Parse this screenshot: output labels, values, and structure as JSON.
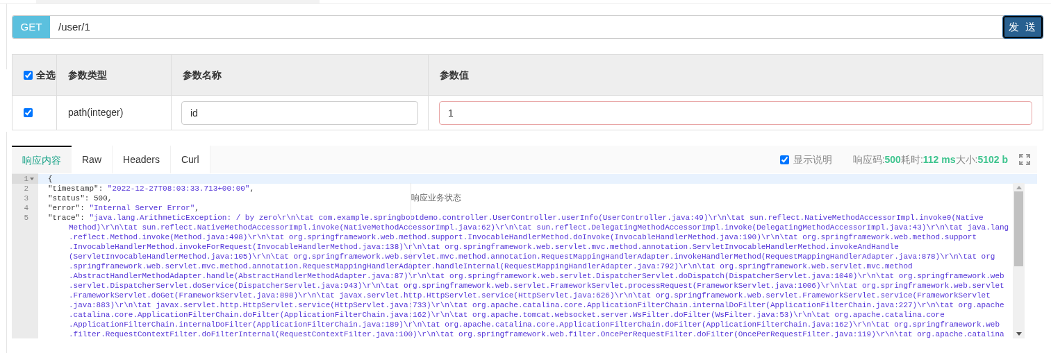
{
  "request": {
    "method": "GET",
    "url": "/user/1",
    "send_label": "发 送"
  },
  "params": {
    "select_all": {
      "label": "全选",
      "checked": true
    },
    "columns": [
      "参数类型",
      "参数名称",
      "参数值"
    ],
    "rows": [
      {
        "checked": true,
        "type": "path(integer)",
        "name": "id",
        "value": "1",
        "invalid": true
      }
    ]
  },
  "response_tabs": [
    {
      "label": "响应内容",
      "selected": true
    },
    {
      "label": "Raw",
      "selected": false
    },
    {
      "label": "Headers",
      "selected": false
    },
    {
      "label": "Curl",
      "selected": false
    }
  ],
  "show_description": {
    "label": "显示说明",
    "checked": true
  },
  "stats": [
    {
      "label": "响应码:",
      "value": "500"
    },
    {
      "label": "耗时:",
      "value": "112 ms"
    },
    {
      "label": "大小:",
      "value": "5102 b"
    }
  ],
  "editor": {
    "lines": [
      {
        "number": "1",
        "active": true,
        "foldable": true,
        "segments": [
          {
            "kind": "punct",
            "text": "{"
          }
        ]
      },
      {
        "number": "2",
        "active": false,
        "foldable": false,
        "segments": [
          {
            "kind": "key",
            "text": "\"timestamp\""
          },
          {
            "kind": "punct",
            "text": ": "
          },
          {
            "kind": "string",
            "text": "\"2022-12-27T08:03:33.713+00:00\""
          },
          {
            "kind": "punct",
            "text": ","
          }
        ]
      },
      {
        "number": "3",
        "active": false,
        "foldable": false,
        "note": "响应业务状态",
        "segments": [
          {
            "kind": "key",
            "text": "\"status\""
          },
          {
            "kind": "punct",
            "text": ": "
          },
          {
            "kind": "number",
            "text": "500"
          },
          {
            "kind": "punct",
            "text": ","
          }
        ]
      },
      {
        "number": "4",
        "active": false,
        "foldable": false,
        "segments": [
          {
            "kind": "key",
            "text": "\"error\""
          },
          {
            "kind": "punct",
            "text": ": "
          },
          {
            "kind": "string",
            "text": "\"Internal Server Error\""
          },
          {
            "kind": "punct",
            "text": ","
          }
        ]
      },
      {
        "number": "5",
        "active": false,
        "foldable": false,
        "segments": [
          {
            "kind": "key",
            "text": "\"trace\""
          },
          {
            "kind": "punct",
            "text": ": "
          },
          {
            "kind": "string",
            "text": "\"java.lang.ArithmeticException: / by zero\\r\\n\\tat com.example.springbootdemo.controller.UserController.userInfo(UserController.java:49)\\r\\n\\tat sun.reflect.NativeMethodAccessorImpl.invoke0(Native"
          }
        ],
        "continuation": [
          "Method)\\r\\n\\tat sun.reflect.NativeMethodAccessorImpl.invoke(NativeMethodAccessorImpl.java:62)\\r\\n\\tat sun.reflect.DelegatingMethodAccessorImpl.invoke(DelegatingMethodAccessorImpl.java:43)\\r\\n\\tat java.lang",
          ".reflect.Method.invoke(Method.java:498)\\r\\n\\tat org.springframework.web.method.support.InvocableHandlerMethod.doInvoke(InvocableHandlerMethod.java:190)\\r\\n\\tat org.springframework.web.method.support",
          ".InvocableHandlerMethod.invokeForRequest(InvocableHandlerMethod.java:138)\\r\\n\\tat org.springframework.web.servlet.mvc.method.annotation.ServletInvocableHandlerMethod.invokeAndHandle",
          "(ServletInvocableHandlerMethod.java:105)\\r\\n\\tat org.springframework.web.servlet.mvc.method.annotation.RequestMappingHandlerAdapter.invokeHandlerMethod(RequestMappingHandlerAdapter.java:878)\\r\\n\\tat org",
          ".springframework.web.servlet.mvc.method.annotation.RequestMappingHandlerAdapter.handleInternal(RequestMappingHandlerAdapter.java:792)\\r\\n\\tat org.springframework.web.servlet.mvc.method",
          ".AbstractHandlerMethodAdapter.handle(AbstractHandlerMethodAdapter.java:87)\\r\\n\\tat org.springframework.web.servlet.DispatcherServlet.doDispatch(DispatcherServlet.java:1040)\\r\\n\\tat org.springframework.web",
          ".servlet.DispatcherServlet.doService(DispatcherServlet.java:943)\\r\\n\\tat org.springframework.web.servlet.FrameworkServlet.processRequest(FrameworkServlet.java:1006)\\r\\n\\tat org.springframework.web.servlet",
          ".FrameworkServlet.doGet(FrameworkServlet.java:898)\\r\\n\\tat javax.servlet.http.HttpServlet.service(HttpServlet.java:626)\\r\\n\\tat org.springframework.web.servlet.FrameworkServlet.service(FrameworkServlet",
          ".java:883)\\r\\n\\tat javax.servlet.http.HttpServlet.service(HttpServlet.java:733)\\r\\n\\tat org.apache.catalina.core.ApplicationFilterChain.internalDoFilter(ApplicationFilterChain.java:227)\\r\\n\\tat org.apache",
          ".catalina.core.ApplicationFilterChain.doFilter(ApplicationFilterChain.java:162)\\r\\n\\tat org.apache.tomcat.websocket.server.WsFilter.doFilter(WsFilter.java:53)\\r\\n\\tat org.apache.catalina.core",
          ".ApplicationFilterChain.internalDoFilter(ApplicationFilterChain.java:189)\\r\\n\\tat org.apache.catalina.core.ApplicationFilterChain.doFilter(ApplicationFilterChain.java:162)\\r\\n\\tat org.springframework.web",
          ".filter.RequestContextFilter.doFilterInternal(RequestContextFilter.java:100)\\r\\n\\tat org.springframework.web.filter.OncePerRequestFilter.doFilter(OncePerRequestFilter.java:119)\\r\\n\\tat org.apache.catalina"
        ]
      }
    ]
  }
}
